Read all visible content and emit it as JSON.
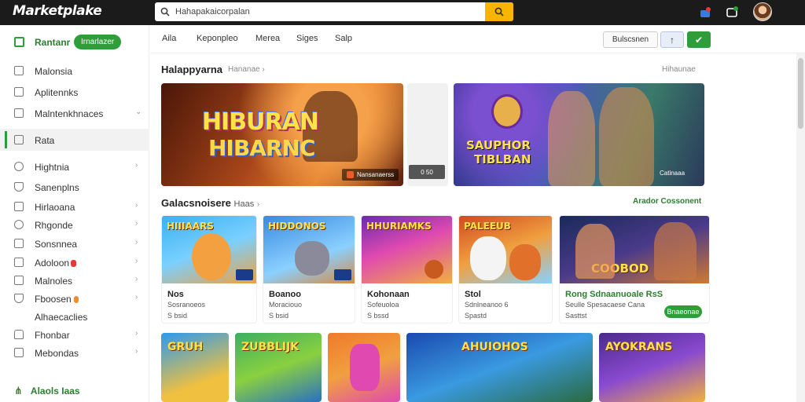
{
  "app": {
    "logo": "Marketplake"
  },
  "search": {
    "value": "Hahapakaicorpalan",
    "placeholder": ""
  },
  "sidebar": {
    "header": {
      "label": "Rantanr",
      "badge": "Irnarlazer"
    },
    "items": [
      {
        "label": "Malonsia",
        "chevron": false
      },
      {
        "label": "Aplitennks",
        "chevron": false
      },
      {
        "label": "Malntenkhnaces",
        "chevron": true
      },
      {
        "label": "Rata",
        "chevron": false,
        "active": true
      },
      {
        "label": "Hightnia",
        "chevron": true
      },
      {
        "label": "Sanenplns",
        "chevron": false
      },
      {
        "label": "Hirlaoana",
        "chevron": true
      },
      {
        "label": "Rhgonde",
        "chevron": true
      },
      {
        "label": "Sonsnnea",
        "chevron": true
      },
      {
        "label": "Adoloon",
        "chevron": true,
        "dot": "red"
      },
      {
        "label": "Malnoles",
        "chevron": true
      },
      {
        "label": "Fboosen",
        "chevron": true,
        "dot": "orange"
      },
      {
        "label": "Alhaecaclies",
        "chevron": false
      },
      {
        "label": "Fhonbar",
        "chevron": true
      },
      {
        "label": "Mebondas",
        "chevron": true
      }
    ],
    "footer": "Alaols Iaas"
  },
  "tabs": [
    "Aila",
    "Keponpleo",
    "Merea",
    "Siges",
    "Salp"
  ],
  "nav": {
    "box_label": "Bulscsnen",
    "btn_a": "↑",
    "btn_b": "✔"
  },
  "section1": {
    "title": "Halappyarna",
    "subtitle": "Hananae",
    "link": "Hihaunae"
  },
  "banners": [
    {
      "line1": "HIBURAN",
      "line2": "HIBARNC",
      "caption": "Nansanaerss"
    },
    {
      "caption": "0 50"
    },
    {
      "line1": "SAUPHOR",
      "line2": "TIBLBAN",
      "caption": "Catinaaa"
    }
  ],
  "section2": {
    "title": "Galacsnoisere",
    "title_suffix": "Haas",
    "link": "Arador Cossonent"
  },
  "cards": [
    {
      "thumb": "HIIIAARS",
      "name": "Nos",
      "meta": "Sosranoeos",
      "price": "S bsid"
    },
    {
      "thumb": "HIDDONOS",
      "name": "Boanoo",
      "meta": "Moraciouo",
      "price": "S bsid"
    },
    {
      "thumb": "HHURIAMKS",
      "name": "Kohonaan",
      "meta": "Sofeuoloa",
      "price": "S bssd"
    },
    {
      "thumb": "PALEEUB",
      "name": "Stol",
      "meta": "Sdnlneanoo 6",
      "price": "Spastd"
    },
    {
      "thumb": "COOBOD",
      "name": "Rong Sdnaanuoale RsS",
      "meta": "Seulle Spesacaese Cana",
      "price": "Sasttst",
      "buy": "Bnaeonae"
    }
  ],
  "tiles": [
    {
      "title": "GRUH"
    },
    {
      "title": "ZUBBLIJK"
    },
    {
      "title": ""
    },
    {
      "title": "AHUIOHOS"
    },
    {
      "title": "AYOKRANS"
    }
  ],
  "colors": {
    "accent": "#2e9d3a",
    "search_btn": "#f7b500",
    "topbar": "#1b1b1b"
  }
}
